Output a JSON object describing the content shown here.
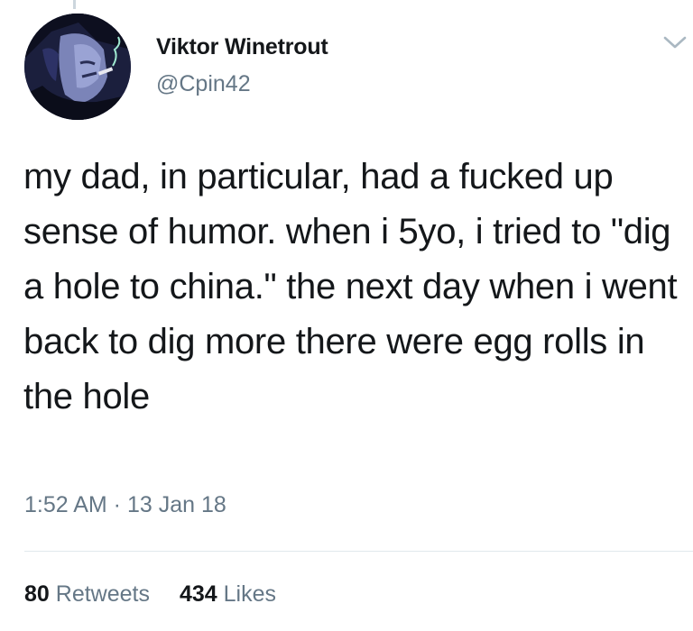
{
  "tweet": {
    "author": {
      "display_name": "Viktor Winetrout",
      "handle": "@Cpin42",
      "avatar_icon": "avatar-image"
    },
    "menu_icon": "chevron-down-icon",
    "text": "my dad, in particular, had a fucked up sense of humor. when i 5yo, i tried to \"dig a hole to china.\" the next day when i went back to dig more there were egg rolls in the hole",
    "timestamp": "1:52 AM · 13 Jan 18",
    "stats": {
      "retweets_count": "80",
      "retweets_label": "Retweets",
      "likes_count": "434",
      "likes_label": "Likes"
    }
  },
  "colors": {
    "text_primary": "#14171a",
    "text_secondary": "#657786",
    "divider": "#e1e8ed",
    "chevron": "#aab8c2"
  }
}
